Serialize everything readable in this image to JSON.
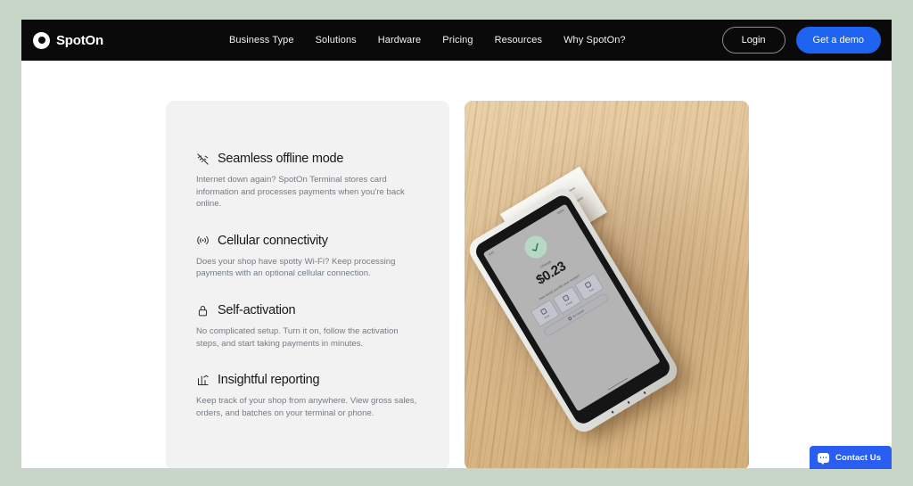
{
  "colors": {
    "page_background": "#c7d6c9",
    "nav_background": "#0a0a0a",
    "accent_blue": "#1f64f0",
    "chat_blue": "#2a5ef0",
    "card_gray": "#f2f2f2",
    "heading_text": "#17181a",
    "body_text": "#737b87",
    "success_green": "#b7d8c4"
  },
  "navbar": {
    "brand": {
      "name": "SpotOn",
      "logo_icon": "spoton-ring-logo-icon"
    },
    "links": [
      {
        "label": "Business Type"
      },
      {
        "label": "Solutions"
      },
      {
        "label": "Hardware"
      },
      {
        "label": "Pricing"
      },
      {
        "label": "Resources"
      },
      {
        "label": "Why SpotOn?"
      }
    ],
    "login_label": "Login",
    "demo_label": "Get a demo"
  },
  "features": [
    {
      "icon": "wifi-off-icon",
      "title": "Seamless offline mode",
      "description": "Internet down again? SpotOn Terminal stores card information and processes payments when you're back online."
    },
    {
      "icon": "cellular-signal-icon",
      "title": "Cellular connectivity",
      "description": "Does your shop have spotty Wi-Fi? Keep processing payments with an optional cellular connection."
    },
    {
      "icon": "lock-icon",
      "title": "Self-activation",
      "description": "No complicated setup. Turn it on, follow the activation steps, and start taking payments in minutes."
    },
    {
      "icon": "bar-chart-icon",
      "title": "Insightful reporting",
      "description": "Keep track of your shop from anywhere. View gross sales, orders, and batches on your terminal or phone."
    }
  ],
  "product_photo": {
    "alt": "SpotOn payment terminal on a wooden table printing a receipt",
    "terminal_screen": {
      "status_left": "9:41",
      "status_right": "100%",
      "success_icon": "check-mark-icon",
      "change_label": "Change",
      "change_amount": "$0.23",
      "receipt_prompt": "How would you like your receipt?",
      "receipt_options": [
        {
          "label": "Print",
          "icon": "printer-icon"
        },
        {
          "label": "Email",
          "icon": "envelope-icon"
        },
        {
          "label": "Text",
          "icon": "message-icon"
        }
      ],
      "no_receipt_label": "No receipt",
      "no_receipt_icon": "circle-slash-icon"
    }
  },
  "chat_widget": {
    "label": "Contact Us",
    "icon": "chat-bubble-icon"
  }
}
